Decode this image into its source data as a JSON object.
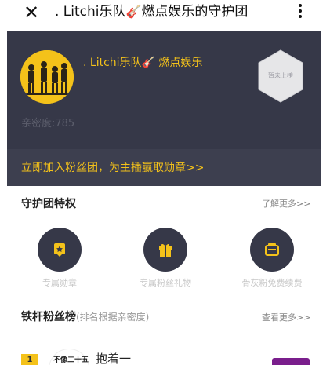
{
  "topbar": {
    "close_symbol": "✕",
    "title": ". Litchi乐队",
    "title_emoji": "🎸",
    "title_suffix": "燃点娱乐的守护团"
  },
  "header": {
    "anchor_name": ". Litchi乐队",
    "anchor_emoji": "🎸",
    "anchor_suffix": " 燃点娱乐",
    "badge_label": "暂未上榜",
    "intimacy_label": "亲密度:",
    "intimacy_value": "785",
    "join_text": "立即加入粉丝团，为主播赢取勋章>>"
  },
  "privileges": {
    "title": "守护团特权",
    "more": "了解更多>>",
    "items": [
      {
        "label": "专属勋章",
        "icon": "medal-icon"
      },
      {
        "label": "专属粉丝礼物",
        "icon": "gift-icon"
      },
      {
        "label": "骨灰粉免费续费",
        "icon": "ticket-icon"
      }
    ]
  },
  "ranking": {
    "title": "铁杆粉丝榜",
    "subtitle": "(排名根据亲密度)",
    "more": "查看更多>>",
    "rows": [
      {
        "rank": "1",
        "avatar_text": "不像二十五",
        "name": "抱着一"
      }
    ]
  },
  "colors": {
    "dark_bg": "#363848",
    "accent_yellow": "#f4c21a",
    "badge_purple": "#7a1e8c"
  }
}
